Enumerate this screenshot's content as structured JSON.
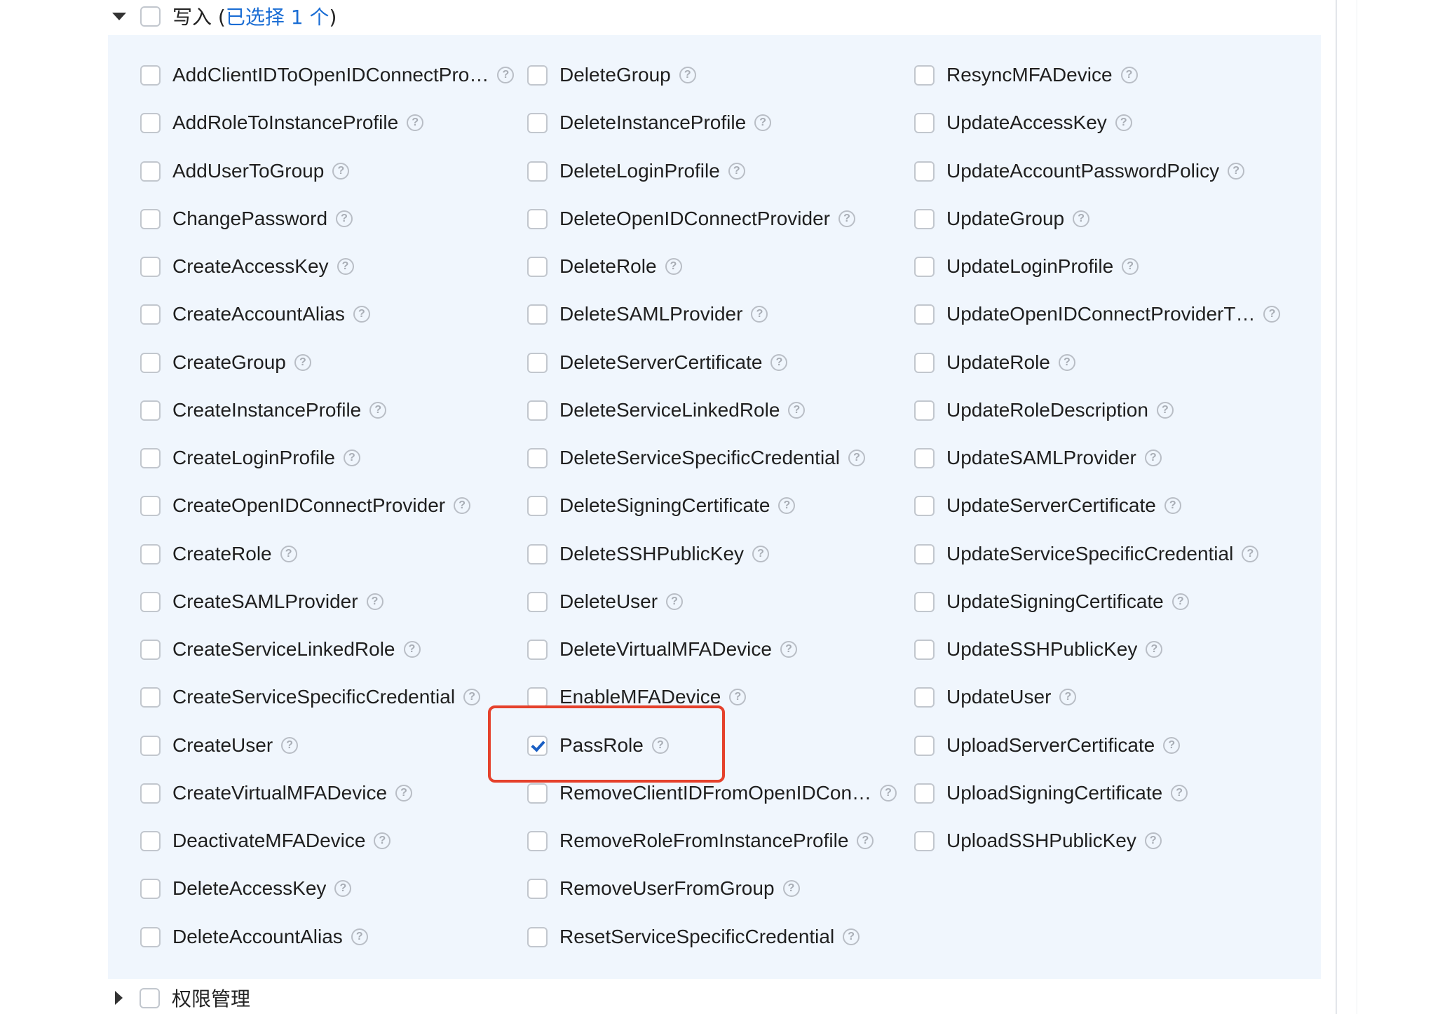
{
  "group_write": {
    "name": "写入",
    "open_paren": " (",
    "selected_text": "已选择 1 个",
    "close_paren": ")",
    "expanded": true
  },
  "group_permission": {
    "name": "权限管理",
    "expanded": false
  },
  "help_glyph": "?",
  "actions": {
    "col1": [
      {
        "label": "AddClientIDToOpenIDConnectPro…",
        "checked": false
      },
      {
        "label": "AddRoleToInstanceProfile",
        "checked": false
      },
      {
        "label": "AddUserToGroup",
        "checked": false
      },
      {
        "label": "ChangePassword",
        "checked": false
      },
      {
        "label": "CreateAccessKey",
        "checked": false
      },
      {
        "label": "CreateAccountAlias",
        "checked": false
      },
      {
        "label": "CreateGroup",
        "checked": false
      },
      {
        "label": "CreateInstanceProfile",
        "checked": false
      },
      {
        "label": "CreateLoginProfile",
        "checked": false
      },
      {
        "label": "CreateOpenIDConnectProvider",
        "checked": false
      },
      {
        "label": "CreateRole",
        "checked": false
      },
      {
        "label": "CreateSAMLProvider",
        "checked": false
      },
      {
        "label": "CreateServiceLinkedRole",
        "checked": false
      },
      {
        "label": "CreateServiceSpecificCredential",
        "checked": false
      },
      {
        "label": "CreateUser",
        "checked": false
      },
      {
        "label": "CreateVirtualMFADevice",
        "checked": false
      },
      {
        "label": "DeactivateMFADevice",
        "checked": false
      },
      {
        "label": "DeleteAccessKey",
        "checked": false
      },
      {
        "label": "DeleteAccountAlias",
        "checked": false
      }
    ],
    "col2": [
      {
        "label": "DeleteGroup",
        "checked": false
      },
      {
        "label": "DeleteInstanceProfile",
        "checked": false
      },
      {
        "label": "DeleteLoginProfile",
        "checked": false
      },
      {
        "label": "DeleteOpenIDConnectProvider",
        "checked": false
      },
      {
        "label": "DeleteRole",
        "checked": false
      },
      {
        "label": "DeleteSAMLProvider",
        "checked": false
      },
      {
        "label": "DeleteServerCertificate",
        "checked": false
      },
      {
        "label": "DeleteServiceLinkedRole",
        "checked": false
      },
      {
        "label": "DeleteServiceSpecificCredential",
        "checked": false
      },
      {
        "label": "DeleteSigningCertificate",
        "checked": false
      },
      {
        "label": "DeleteSSHPublicKey",
        "checked": false
      },
      {
        "label": "DeleteUser",
        "checked": false
      },
      {
        "label": "DeleteVirtualMFADevice",
        "checked": false
      },
      {
        "label": "EnableMFADevice",
        "checked": false
      },
      {
        "label": "PassRole",
        "checked": true
      },
      {
        "label": "RemoveClientIDFromOpenIDCon…",
        "checked": false
      },
      {
        "label": "RemoveRoleFromInstanceProfile",
        "checked": false
      },
      {
        "label": "RemoveUserFromGroup",
        "checked": false
      },
      {
        "label": "ResetServiceSpecificCredential",
        "checked": false
      }
    ],
    "col3": [
      {
        "label": "ResyncMFADevice",
        "checked": false
      },
      {
        "label": "UpdateAccessKey",
        "checked": false
      },
      {
        "label": "UpdateAccountPasswordPolicy",
        "checked": false
      },
      {
        "label": "UpdateGroup",
        "checked": false
      },
      {
        "label": "UpdateLoginProfile",
        "checked": false
      },
      {
        "label": "UpdateOpenIDConnectProviderT…",
        "checked": false
      },
      {
        "label": "UpdateRole",
        "checked": false
      },
      {
        "label": "UpdateRoleDescription",
        "checked": false
      },
      {
        "label": "UpdateSAMLProvider",
        "checked": false
      },
      {
        "label": "UpdateServerCertificate",
        "checked": false
      },
      {
        "label": "UpdateServiceSpecificCredential",
        "checked": false
      },
      {
        "label": "UpdateSigningCertificate",
        "checked": false
      },
      {
        "label": "UpdateSSHPublicKey",
        "checked": false
      },
      {
        "label": "UpdateUser",
        "checked": false
      },
      {
        "label": "UploadServerCertificate",
        "checked": false
      },
      {
        "label": "UploadSigningCertificate",
        "checked": false
      },
      {
        "label": "UploadSSHPublicKey",
        "checked": false
      }
    ]
  }
}
